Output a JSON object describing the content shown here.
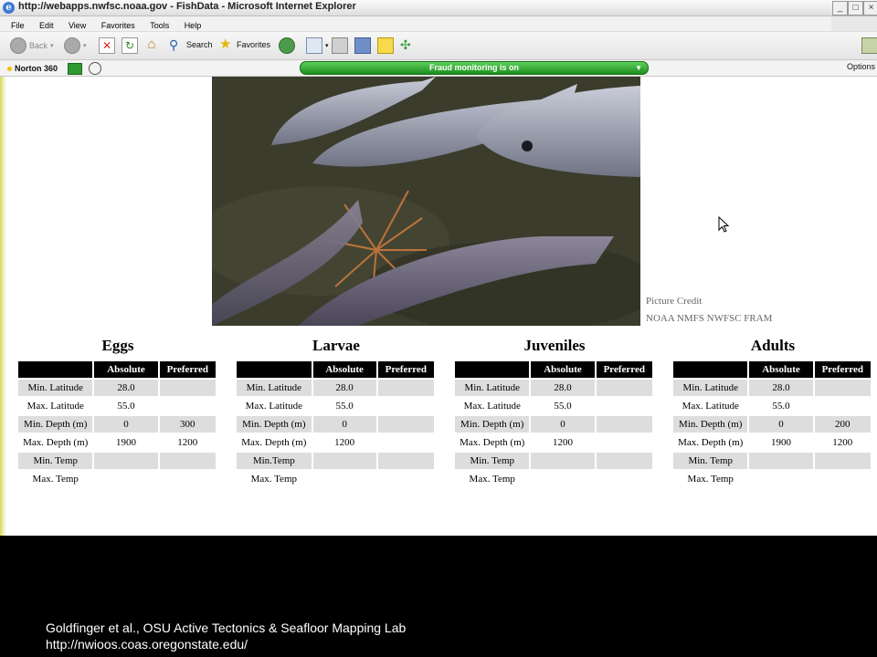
{
  "window": {
    "title": "http://webapps.nwfsc.noaa.gov - FishData - Microsoft Internet Explorer",
    "controls": [
      "_",
      "□",
      "×"
    ]
  },
  "menu": [
    "File",
    "Edit",
    "View",
    "Favorites",
    "Tools",
    "Help"
  ],
  "toolbar": {
    "back": "Back",
    "search": "Search",
    "favorites": "Favorites"
  },
  "norton": {
    "label": "Norton 360",
    "fraud": "Fraud monitoring is on",
    "options": "Options"
  },
  "credit": {
    "label": "Picture Credit",
    "source": "NOAA NMFS NWFSC FRAM"
  },
  "tables": [
    {
      "title": "Eggs",
      "headers": [
        "",
        "Absolute",
        "Preferred"
      ],
      "rows": [
        [
          "Min. Latitude",
          "28.0",
          ""
        ],
        [
          "Max. Latitude",
          "55.0",
          ""
        ],
        [
          "Min. Depth (m)",
          "0",
          "300"
        ],
        [
          "Max. Depth (m)",
          "1900",
          "1200"
        ],
        [
          "Min. Temp",
          "",
          ""
        ],
        [
          "Max. Temp",
          "",
          ""
        ]
      ]
    },
    {
      "title": "Larvae",
      "headers": [
        "",
        "Absolute",
        "Preferred"
      ],
      "rows": [
        [
          "Min. Latitude",
          "28.0",
          ""
        ],
        [
          "Max. Latitude",
          "55.0",
          ""
        ],
        [
          "Min. Depth (m)",
          "0",
          ""
        ],
        [
          "Max. Depth (m)",
          "1200",
          ""
        ],
        [
          "Min.Temp",
          "",
          ""
        ],
        [
          "Max. Temp",
          "",
          ""
        ]
      ]
    },
    {
      "title": "Juveniles",
      "headers": [
        "",
        "Absolute",
        "Preferred"
      ],
      "rows": [
        [
          "Min. Latitude",
          "28.0",
          ""
        ],
        [
          "Max. Latitude",
          "55.0",
          ""
        ],
        [
          "Min. Depth (m)",
          "0",
          ""
        ],
        [
          "Max. Depth (m)",
          "1200",
          ""
        ],
        [
          "Min. Temp",
          "",
          ""
        ],
        [
          "Max. Temp",
          "",
          ""
        ]
      ]
    },
    {
      "title": "Adults",
      "headers": [
        "",
        "Absolute",
        "Preferred"
      ],
      "rows": [
        [
          "Min. Latitude",
          "28.0",
          ""
        ],
        [
          "Max. Latitude",
          "55.0",
          ""
        ],
        [
          "Min. Depth (m)",
          "0",
          "200"
        ],
        [
          "Max. Depth (m)",
          "1900",
          "1200"
        ],
        [
          "Min. Temp",
          "",
          ""
        ],
        [
          "Max. Temp",
          "",
          ""
        ]
      ]
    }
  ],
  "caption": {
    "line1": "Goldfinger et al., OSU Active Tectonics & Seafloor Mapping Lab",
    "line2": "http://nwioos.coas.oregonstate.edu/"
  },
  "colors": {
    "table_header": "#000000",
    "row_alt": "#dddddd",
    "fraud_bar": "#2aa52a"
  }
}
